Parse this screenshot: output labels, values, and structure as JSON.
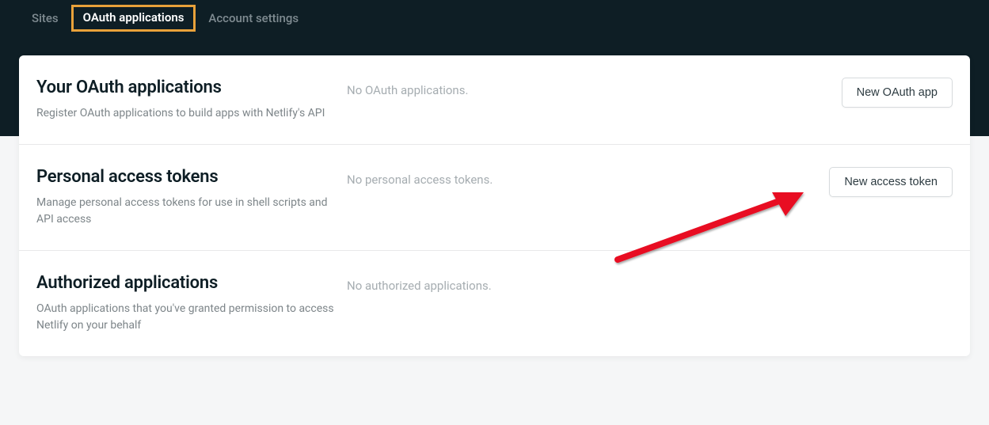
{
  "nav": {
    "tabs": [
      {
        "label": "Sites",
        "active": false
      },
      {
        "label": "OAuth applications",
        "active": true
      },
      {
        "label": "Account settings",
        "active": false
      }
    ]
  },
  "sections": {
    "oauth_apps": {
      "title": "Your OAuth applications",
      "description": "Register OAuth applications to build apps with Netlify's API",
      "empty_message": "No OAuth applications.",
      "button_label": "New OAuth app"
    },
    "personal_tokens": {
      "title": "Personal access tokens",
      "description": "Manage personal access tokens for use in shell scripts and API access",
      "empty_message": "No personal access tokens.",
      "button_label": "New access token"
    },
    "authorized_apps": {
      "title": "Authorized applications",
      "description": "OAuth applications that you've granted permission to access Netlify on your behalf",
      "empty_message": "No authorized applications."
    }
  },
  "annotation": {
    "arrow_color": "#e81123"
  }
}
